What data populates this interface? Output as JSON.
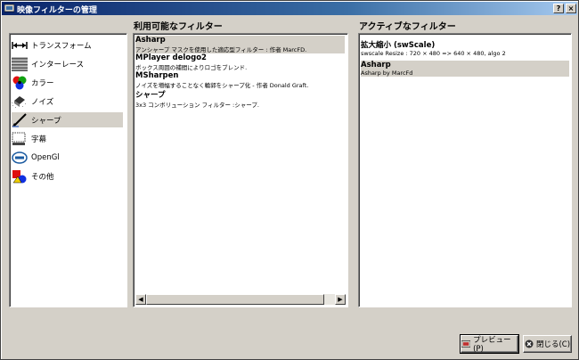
{
  "window": {
    "title": "映像フィルターの管理",
    "help_label": "?",
    "close_label": "×"
  },
  "categories": [
    {
      "label": "トランスフォーム",
      "icon": "transform-icon",
      "selected": false
    },
    {
      "label": "インターレース",
      "icon": "interlace-icon",
      "selected": false
    },
    {
      "label": "カラー",
      "icon": "color-icon",
      "selected": false
    },
    {
      "label": "ノイズ",
      "icon": "noise-icon",
      "selected": false
    },
    {
      "label": "シャープ",
      "icon": "sharpen-icon",
      "selected": true
    },
    {
      "label": "字幕",
      "icon": "subtitle-icon",
      "selected": false
    },
    {
      "label": "OpenGl",
      "icon": "opengl-icon",
      "selected": false
    },
    {
      "label": "その他",
      "icon": "misc-icon",
      "selected": false
    }
  ],
  "available": {
    "heading": "利用可能なフィルター",
    "items": [
      {
        "name": "Asharp",
        "desc": "アンシャープ マスクを使用した適応型フィルター : 作者 MarcFD.",
        "selected": true
      },
      {
        "name": "MPlayer delogo2",
        "desc": "ボックス周囲の補間によりロゴをブレンド.",
        "selected": false
      },
      {
        "name": "MSharpen",
        "desc": "ノイズを増幅することなく輪郭をシャープ化 - 作者 Donald Graft.",
        "selected": false
      },
      {
        "name": "シャープ",
        "desc": "3x3 コンボリューション フィルター :シャープ.",
        "selected": false
      }
    ]
  },
  "active": {
    "heading": "アクティブなフィルター",
    "items": [
      {
        "name": "拡大縮小 (swScale)",
        "desc": "swscale Resize : 720 × 480 => 640 × 480, algo 2",
        "selected": false
      },
      {
        "name": "Asharp",
        "desc": "Asharp by MarcFd",
        "selected": true
      }
    ]
  },
  "buttons": {
    "preview": "プレビュー(P)",
    "close": "閉じる(C)"
  },
  "scrollbar": {
    "left_arrow": "◀",
    "right_arrow": "▶"
  }
}
